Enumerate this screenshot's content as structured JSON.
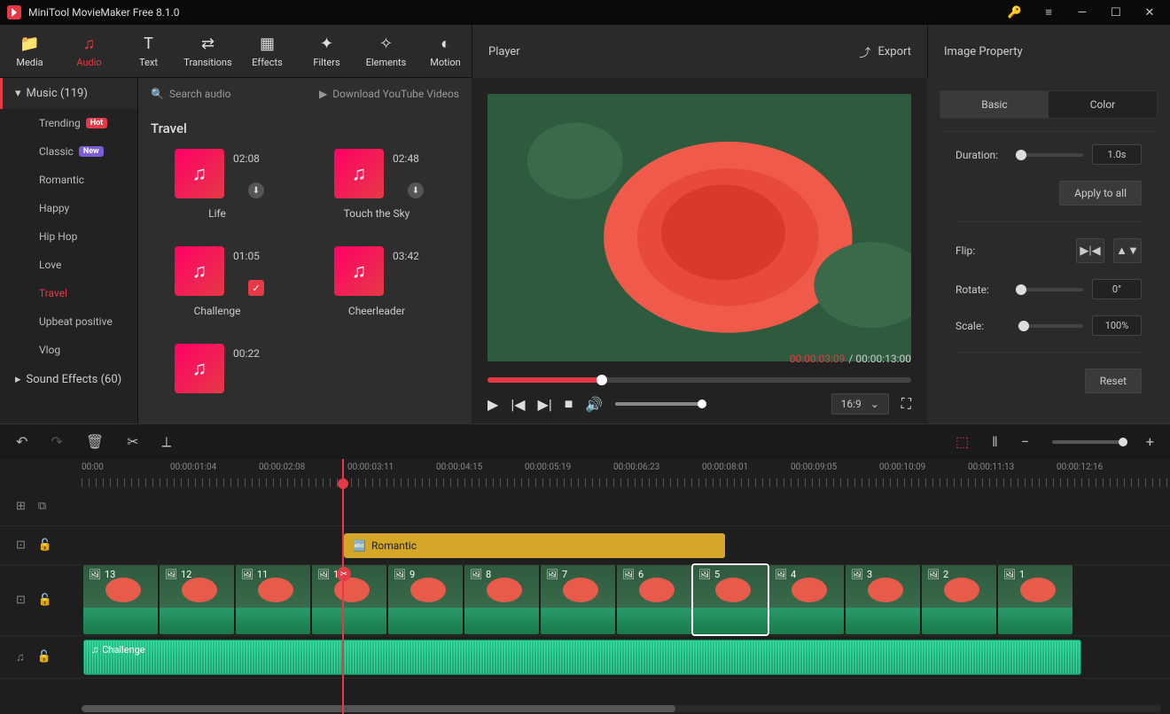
{
  "app": {
    "title": "MiniTool MovieMaker Free 8.1.0"
  },
  "tools": [
    {
      "label": "Media",
      "icon": "📁"
    },
    {
      "label": "Audio",
      "icon": "♫",
      "active": true
    },
    {
      "label": "Text",
      "icon": "T"
    },
    {
      "label": "Transitions",
      "icon": "⇄"
    },
    {
      "label": "Effects",
      "icon": "▦"
    },
    {
      "label": "Filters",
      "icon": "✦"
    },
    {
      "label": "Elements",
      "icon": "✧"
    },
    {
      "label": "Motion",
      "icon": "◐"
    }
  ],
  "sidebar": {
    "music": {
      "label": "Music (119)"
    },
    "items": [
      {
        "label": "Trending",
        "badge": "Hot",
        "badgeClass": "hot"
      },
      {
        "label": "Classic",
        "badge": "New",
        "badgeClass": "new"
      },
      {
        "label": "Romantic"
      },
      {
        "label": "Happy"
      },
      {
        "label": "Hip Hop"
      },
      {
        "label": "Love"
      },
      {
        "label": "Travel",
        "active": true
      },
      {
        "label": "Upbeat positive"
      },
      {
        "label": "Vlog"
      }
    ],
    "sfx": {
      "label": "Sound Effects (60)"
    }
  },
  "library": {
    "search_placeholder": "Search audio",
    "download": "Download YouTube Videos",
    "title": "Travel",
    "items": [
      {
        "name": "Life",
        "dur": "02:08",
        "dl": true
      },
      {
        "name": "Touch the Sky",
        "dur": "02:48",
        "dl": true
      },
      {
        "name": "Challenge",
        "dur": "01:05",
        "checked": true
      },
      {
        "name": "Cheerleader",
        "dur": "03:42"
      },
      {
        "name": "",
        "dur": "00:22"
      }
    ]
  },
  "player": {
    "title": "Player",
    "export": "Export",
    "cur": "00:00:03:09",
    "total": "00:00:13:00",
    "aspect": "16:9"
  },
  "props": {
    "title": "Image Property",
    "tabs": {
      "basic": "Basic",
      "color": "Color"
    },
    "duration": {
      "label": "Duration:",
      "value": "1.0s"
    },
    "apply": "Apply to all",
    "flip": "Flip:",
    "rotate": {
      "label": "Rotate:",
      "value": "0°"
    },
    "scale": {
      "label": "Scale:",
      "value": "100%"
    },
    "reset": "Reset"
  },
  "ruler": [
    {
      "t": "00:00",
      "l": 0
    },
    {
      "t": "00:00:01:04",
      "l": 100
    },
    {
      "t": "00:00:02:08",
      "l": 200
    },
    {
      "t": "00:00:03:11",
      "l": 300
    },
    {
      "t": "00:00:04:15",
      "l": 400
    },
    {
      "t": "00:00:05:19",
      "l": 500
    },
    {
      "t": "00:00:06:23",
      "l": 600
    },
    {
      "t": "00:00:08:01",
      "l": 700
    },
    {
      "t": "00:00:09:05",
      "l": 800
    },
    {
      "t": "00:00:10:09",
      "l": 900
    },
    {
      "t": "00:00:11:13",
      "l": 1000
    },
    {
      "t": "00:00:12:16",
      "l": 1100
    }
  ],
  "textClip": {
    "label": "Romantic"
  },
  "vidClips": [
    13,
    12,
    11,
    10,
    9,
    8,
    7,
    6,
    5,
    4,
    3,
    2,
    1
  ],
  "vidSelected": 5,
  "audioClip": {
    "label": "Challenge"
  }
}
